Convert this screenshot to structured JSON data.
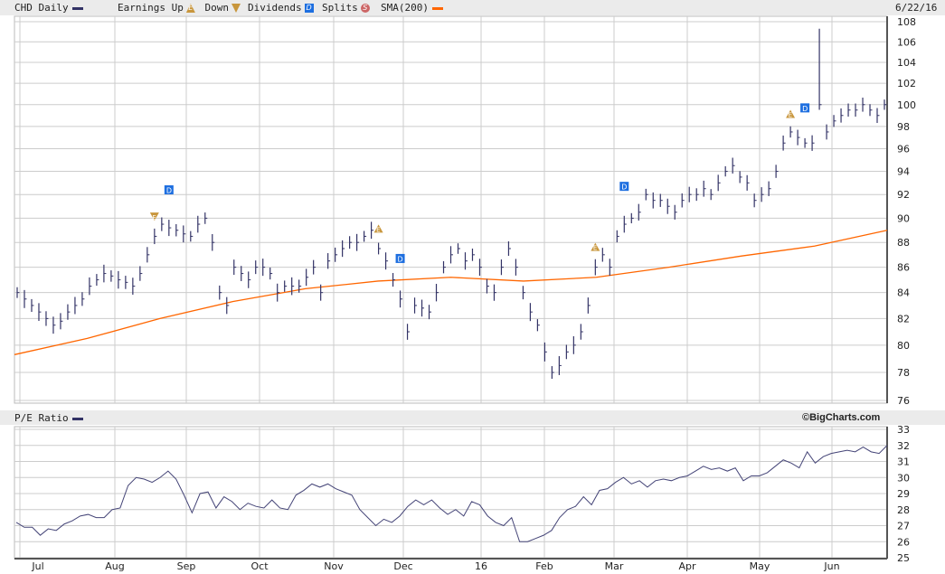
{
  "header": {
    "symbol_label": "CHD Daily",
    "earnings_label": "Earnings Up",
    "down_label": "Down",
    "dividends_label": "Dividends",
    "splits_label": "Splits",
    "sma_label": "SMA(200)",
    "date": "6/22/16",
    "earn_glyph": "E",
    "div_glyph": "D",
    "split_glyph": "S"
  },
  "pe_header": {
    "label": "P/E Ratio",
    "copyright": "©BigCharts.com"
  },
  "colors": {
    "price": "#333366",
    "sma": "#ff6600",
    "grid": "#cccccc",
    "dividend": "#1e6fe0",
    "earnings": "#c8963c",
    "split": "#cc6666"
  },
  "chart_data": [
    {
      "type": "ohlc",
      "title": "CHD Daily",
      "scale": "log",
      "ylim": [
        76,
        108
      ],
      "yticks": [
        76,
        78,
        80,
        82,
        84,
        86,
        88,
        90,
        92,
        94,
        96,
        98,
        100,
        102,
        104,
        106,
        108
      ],
      "xticks": [
        "Jul",
        "Aug",
        "Sep",
        "Oct",
        "Nov",
        "Dec",
        "16",
        "Feb",
        "Mar",
        "Apr",
        "May",
        "Jun"
      ],
      "bar_range": 1.4,
      "closes": [
        84,
        83.5,
        83,
        82.5,
        82,
        81.5,
        81.8,
        82.5,
        83,
        83.5,
        84.5,
        85,
        85.5,
        85.3,
        85,
        84.8,
        84.5,
        85.5,
        87,
        88.5,
        89.5,
        89.2,
        89,
        88.7,
        88.5,
        89.5,
        90,
        88,
        84,
        83,
        86,
        85.5,
        85,
        86,
        86,
        85.5,
        84,
        84.5,
        84.5,
        84.5,
        85.2,
        86,
        84,
        86.5,
        87,
        87.5,
        88,
        88,
        88.5,
        89,
        87.5,
        86.5,
        85,
        83.5,
        81,
        83,
        82.8,
        82.5,
        84,
        86,
        87,
        87.5,
        86.5,
        87,
        86,
        84.5,
        84,
        86,
        87.5,
        86,
        84,
        82.5,
        81.5,
        79.5,
        78,
        78.5,
        79.5,
        80,
        81,
        83,
        86,
        87,
        86,
        88.5,
        89.5,
        90,
        90.5,
        92,
        91.5,
        91.5,
        91,
        90.5,
        91.5,
        92,
        92,
        92.5,
        92,
        93,
        94,
        94.5,
        93.5,
        93,
        91.5,
        92,
        92.5,
        94,
        96.5,
        97.5,
        97,
        96.5,
        96.5,
        100,
        97.5,
        98.5,
        99,
        99.5,
        99.5,
        100,
        99.5,
        99,
        100
      ],
      "spike": {
        "index": 111,
        "high": 107.3
      },
      "sma200": [
        79.3,
        80.5,
        82.0,
        83.3,
        84.3,
        84.9,
        85.2,
        84.9,
        85.2,
        86.0,
        86.9,
        87.7,
        89.0
      ],
      "earnings": [
        {
          "index": 19,
          "dir": "down"
        },
        {
          "index": 50,
          "dir": "up"
        },
        {
          "index": 80,
          "dir": "up"
        },
        {
          "index": 107,
          "dir": "up"
        }
      ],
      "dividends": [
        {
          "index": 21
        },
        {
          "index": 53
        },
        {
          "index": 84
        },
        {
          "index": 109
        }
      ]
    },
    {
      "type": "line",
      "title": "P/E Ratio",
      "ylim": [
        25,
        33
      ],
      "yticks": [
        25,
        26,
        27,
        28,
        29,
        30,
        31,
        32,
        33
      ],
      "values": [
        27.2,
        26.9,
        26.9,
        26.4,
        26.8,
        26.7,
        27.1,
        27.3,
        27.6,
        27.7,
        27.5,
        27.5,
        28.0,
        28.1,
        29.5,
        30.0,
        29.9,
        29.7,
        30.0,
        30.4,
        29.9,
        28.9,
        27.8,
        29.0,
        29.1,
        28.1,
        28.8,
        28.5,
        28.0,
        28.4,
        28.2,
        28.1,
        28.6,
        28.1,
        28.0,
        28.9,
        29.2,
        29.6,
        29.4,
        29.6,
        29.3,
        29.1,
        28.9,
        28.0,
        27.5,
        27.0,
        27.4,
        27.2,
        27.6,
        28.2,
        28.6,
        28.3,
        28.6,
        28.1,
        27.7,
        28.0,
        27.6,
        28.5,
        28.3,
        27.6,
        27.2,
        27.0,
        27.5,
        26.0,
        26.0,
        26.2,
        26.4,
        26.7,
        27.5,
        28.0,
        28.2,
        28.8,
        28.3,
        29.2,
        29.3,
        29.7,
        30.0,
        29.6,
        29.8,
        29.4,
        29.8,
        29.9,
        29.8,
        30.0,
        30.1,
        30.4,
        30.7,
        30.5,
        30.6,
        30.4,
        30.6,
        29.8,
        30.1,
        30.1,
        30.3,
        30.7,
        31.1,
        30.9,
        30.6,
        31.6,
        30.9,
        31.3,
        31.5,
        31.6,
        31.7,
        31.6,
        31.9,
        31.6,
        31.5,
        32.0
      ]
    }
  ]
}
